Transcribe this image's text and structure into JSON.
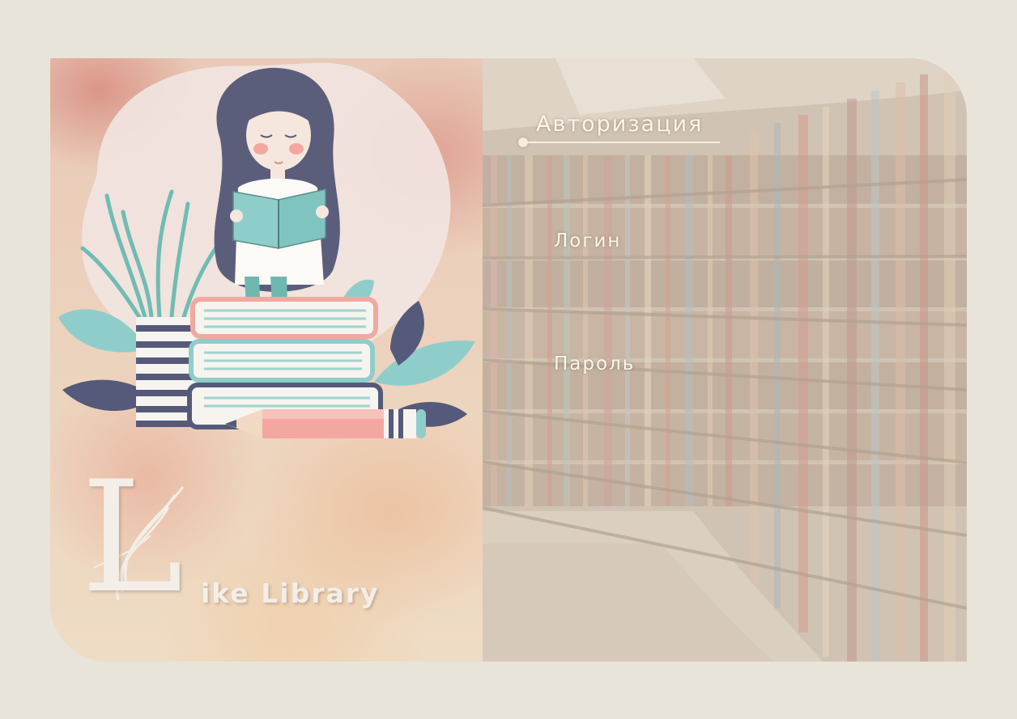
{
  "auth": {
    "title": "Авторизация",
    "login_label": "Логин",
    "login_value": "",
    "password_label": "Пароль",
    "password_value": ""
  },
  "logo": {
    "letter": "L",
    "text": "ike Library"
  },
  "colors": {
    "page_background": "#e9e4d9",
    "label_text": "#fbf6ea",
    "accent_teal": "#7fc4bf",
    "accent_navy": "#555a7a",
    "accent_pink": "#f0a9a0"
  },
  "icons": [
    "girl-reading-illustration",
    "logo-mark",
    "book-stack",
    "pencil"
  ]
}
